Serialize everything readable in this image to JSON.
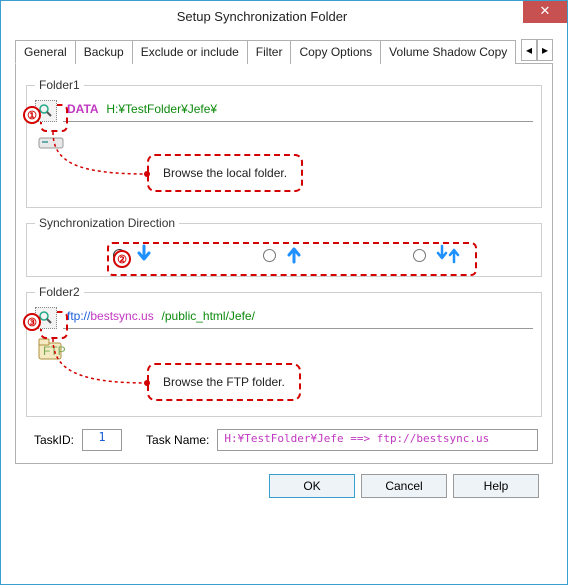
{
  "window": {
    "title": "Setup Synchronization Folder"
  },
  "tabs": [
    "General",
    "Backup",
    "Exclude or include",
    "Filter",
    "Copy Options",
    "Volume Shadow Copy"
  ],
  "folder1": {
    "legend": "Folder1",
    "path_label": "DATA",
    "path_value": "H:¥TestFolder¥Jefe¥",
    "annotation": "Browse the local folder.",
    "marker": "①"
  },
  "sync": {
    "legend": "Synchronization Direction",
    "marker": "②",
    "options": [
      {
        "dir": "down",
        "checked": true
      },
      {
        "dir": "up",
        "checked": false
      },
      {
        "dir": "both",
        "checked": false
      }
    ]
  },
  "folder2": {
    "legend": "Folder2",
    "path_scheme": "ftp://",
    "path_host": "bestsync.us",
    "path_path": "/public_html/Jefe/",
    "annotation": "Browse the FTP folder.",
    "marker": "③"
  },
  "task": {
    "id_label": "TaskID:",
    "id_value": "1",
    "name_label": "Task Name:",
    "name_value": "H:¥TestFolder¥Jefe ==> ftp://bestsync.us"
  },
  "buttons": {
    "ok": "OK",
    "cancel": "Cancel",
    "help": "Help"
  },
  "icons": {
    "magnifier": "search-icon",
    "drive": "drive-icon",
    "ftp": "ftp-icon",
    "arrow_down": "arrow-down-icon",
    "arrow_up": "arrow-up-icon",
    "arrow_both": "arrow-updown-icon"
  }
}
